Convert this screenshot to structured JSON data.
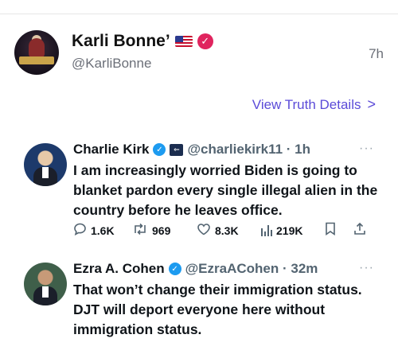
{
  "post": {
    "display_name": "Karli Bonne’",
    "handle": "@KarliBonne",
    "time": "7h",
    "view_details_label": "View Truth Details",
    "view_details_chevron": ">"
  },
  "embedded": [
    {
      "name": "Charlie Kirk",
      "handle": "@charliekirk11 · 1h",
      "more": "···",
      "text": "I am increasingly worried Biden is going to blanket pardon every single illegal alien in the country before he leaves office.",
      "stats": {
        "replies": "1.6K",
        "reposts": "969",
        "likes": "8.3K",
        "views": "219K"
      }
    },
    {
      "name": "Ezra A. Cohen",
      "handle": "@EzraACohen · 32m",
      "more": "···",
      "text": "That won’t change their immigration status. DJT will deport everyone here without immigration status."
    }
  ],
  "colors": {
    "link": "#5b4bd8",
    "verified_truth": "#e0245e",
    "verified_x": "#1d9bf0",
    "secondary_text": "#536471"
  },
  "icons": {
    "reply": "speech-bubble",
    "repost": "retweet-arrows",
    "like": "heart-outline",
    "views": "bar-chart",
    "bookmark": "bookmark-outline",
    "share": "share-arrow-up"
  }
}
